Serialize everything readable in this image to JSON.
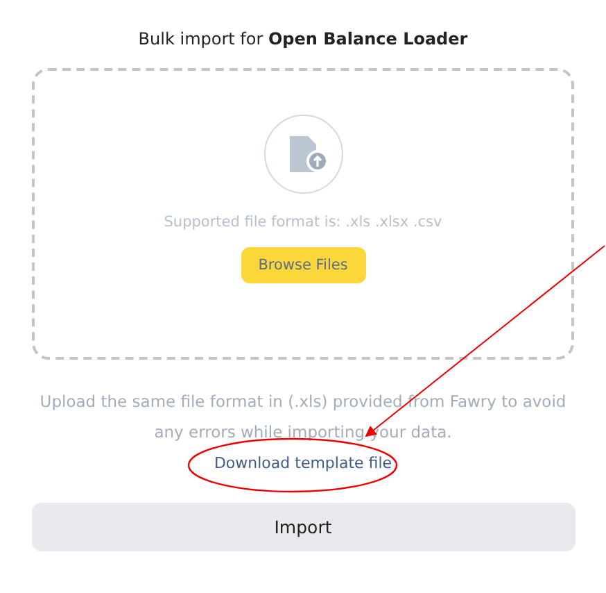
{
  "title": "Bulk import for **Open Balance Loader**",
  "dropzone": {
    "hint": "Supported file format is: .xls .xlsx .csv",
    "browse_button": "Browse Files"
  },
  "note": "Upload the same file format in (.xls) provided from Fawry to avoid any errors while importing your data.",
  "template_link": "Download template file",
  "import_button": "Import"
}
